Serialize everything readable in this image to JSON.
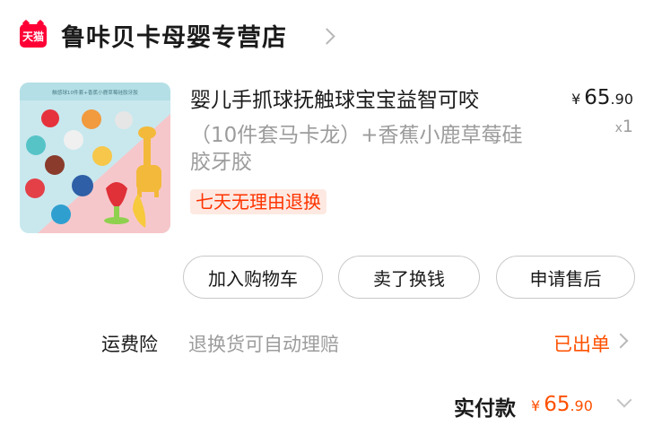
{
  "shop": {
    "logo_text": "天猫",
    "name": "鲁咔贝卡母婴专营店"
  },
  "product": {
    "title_line1": "婴儿手抓球抚触球宝宝益智可咬",
    "title_line2": "（10件套马卡龙）+香蕉小鹿草莓硅胶牙胶",
    "price_currency": "¥",
    "price_int": "65",
    "price_dec": ".90",
    "qty_prefix": "x",
    "qty": "1",
    "badge": "七天无理由退换",
    "image_caption": "触感球10件套+香蕉小鹿草莓硅胶牙胶"
  },
  "actions": {
    "add_to_cart": "加入购物车",
    "resell": "卖了换钱",
    "after_sales": "申请售后"
  },
  "insurance": {
    "label": "运费险",
    "desc": "退换货可自动理赔",
    "status": "已出单"
  },
  "total": {
    "label": "实付款",
    "currency": "¥",
    "int": "65",
    "dec": ".90"
  },
  "colors": {
    "accent": "#ff5000",
    "tmall_red": "#ff0036",
    "badge_bg": "#fde9e2"
  }
}
